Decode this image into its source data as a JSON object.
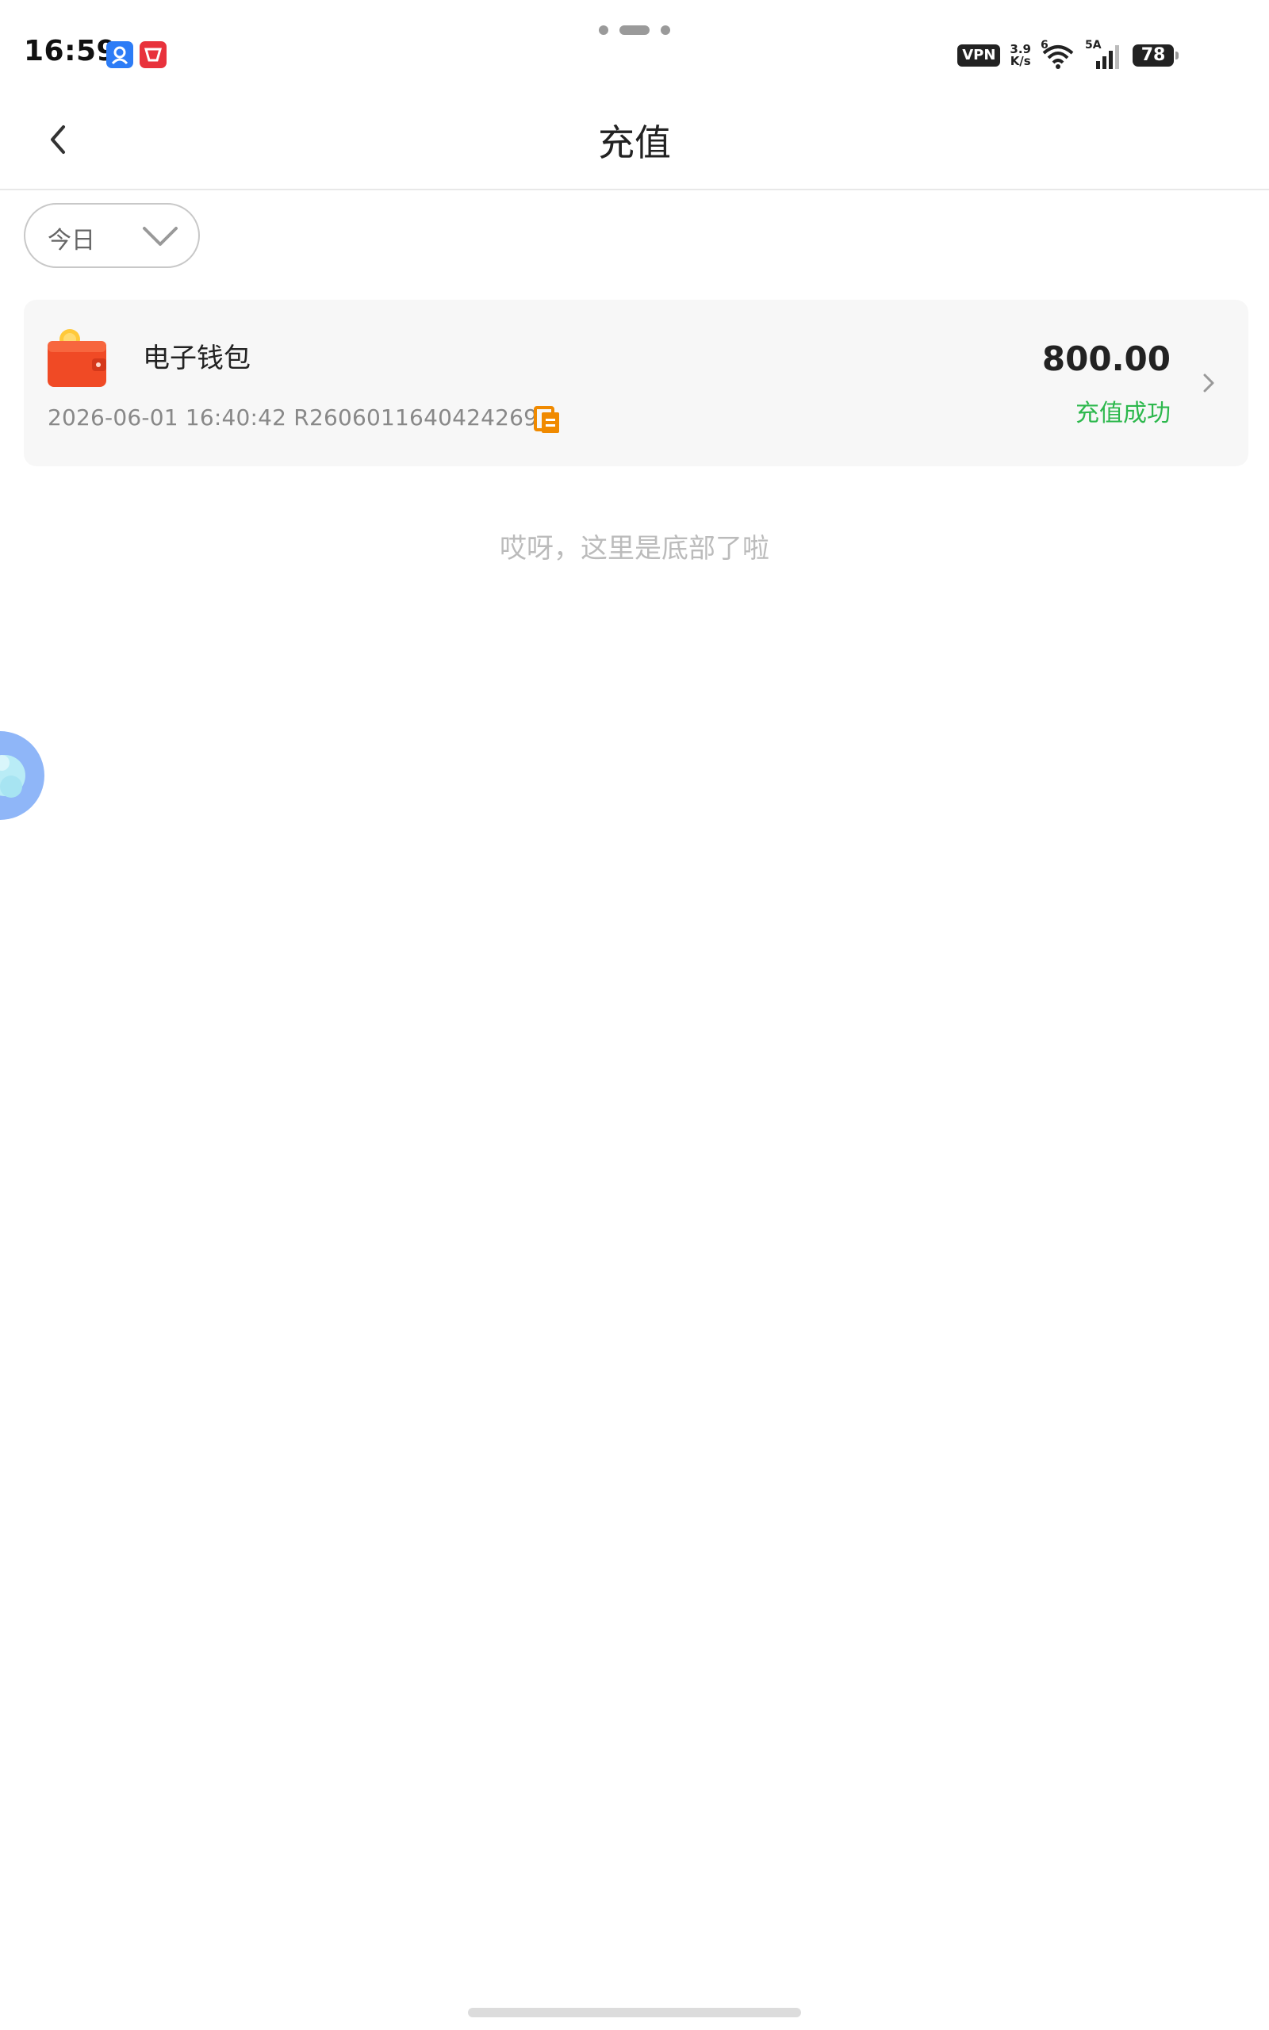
{
  "status_bar": {
    "time": "16:59",
    "vpn_label": "VPN",
    "net_speed_value": "3.9",
    "net_speed_unit": "K/s",
    "wifi_label": "6",
    "signal_label": "5A",
    "battery_level": "78"
  },
  "nav": {
    "title": "充值"
  },
  "filter": {
    "selected": "今日"
  },
  "records": [
    {
      "title": "电子钱包",
      "datetime": "2026-06-01 16:40:42",
      "order_no": "R2606011640424269",
      "amount": "800.00",
      "status": "充值成功"
    }
  ],
  "footer": {
    "end_text": "哎呀，这里是底部了啦"
  },
  "colors": {
    "success": "#2db84d",
    "copy_icon": "#f08a00",
    "wallet": "#f04a25",
    "assistant_bubble": "#8fb6f8"
  },
  "icons": {
    "back": "chevron-left-icon",
    "filter": "chevron-down-icon",
    "record": "wallet-icon",
    "copy": "copy-icon",
    "detail": "chevron-right-icon"
  }
}
